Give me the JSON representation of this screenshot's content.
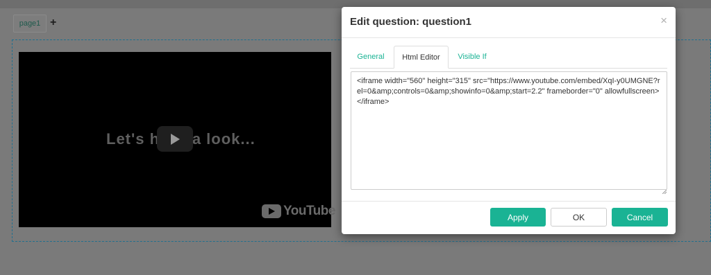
{
  "designer": {
    "page_tab_label": "page1",
    "add_page_symbol": "+",
    "video": {
      "caption": "Let's have a look...",
      "brand": "YouTube"
    }
  },
  "modal": {
    "title": "Edit question: question1",
    "close_symbol": "×",
    "tabs": [
      {
        "label": "General"
      },
      {
        "label": "Html Editor",
        "active": true
      },
      {
        "label": "Visible If"
      }
    ],
    "editor_value": "<iframe width=\"560\" height=\"315\" src=\"https://www.youtube.com/embed/XqI-y0UMGNE?rel=0&amp;controls=0&amp;showinfo=0&amp;start=2.2\" frameborder=\"0\" allowfullscreen></iframe>",
    "buttons": {
      "apply": "Apply",
      "ok": "OK",
      "cancel": "Cancel"
    }
  },
  "colors": {
    "accent": "#1ab394",
    "overlay": "#7a7a7a"
  },
  "icons": {
    "play": "play-icon",
    "youtube": "youtube-logo",
    "close": "close-icon",
    "add": "plus-icon"
  }
}
